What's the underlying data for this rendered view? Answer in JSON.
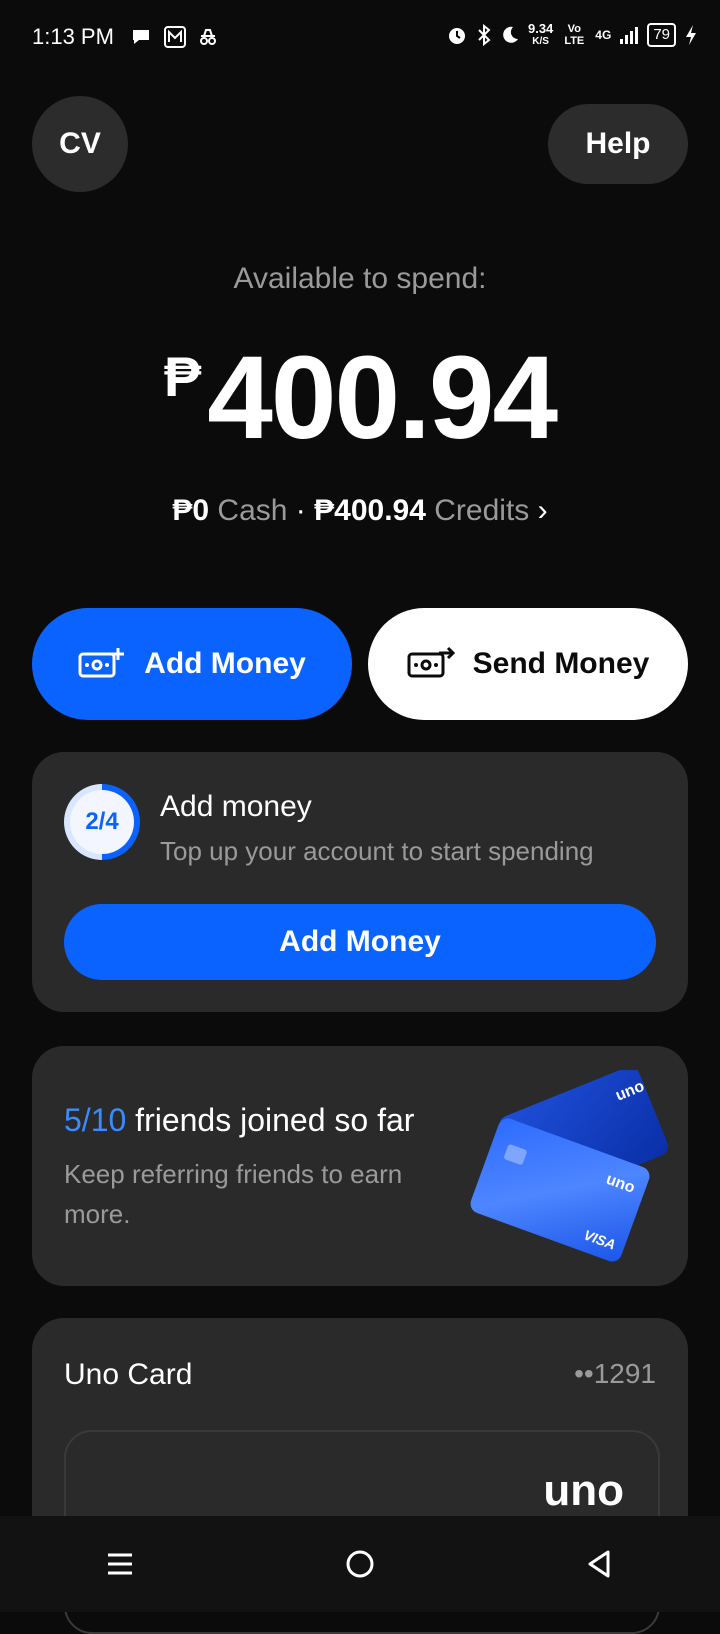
{
  "status_bar": {
    "time": "1:13 PM",
    "speed": "9.34",
    "speed_unit": "K/S",
    "network": "Vo LTE",
    "signal": "4G",
    "battery": "79"
  },
  "header": {
    "avatar_initials": "CV",
    "help_label": "Help"
  },
  "balance": {
    "label": "Available to spend:",
    "currency": "₱",
    "amount": "400.94",
    "cash_amount": "₱0",
    "cash_label": "Cash",
    "separator": "·",
    "credits_amount": "₱400.94",
    "credits_label": "Credits"
  },
  "actions": {
    "add_money": "Add Money",
    "send_money": "Send Money"
  },
  "progress_card": {
    "step": "2/4",
    "title": "Add money",
    "subtitle": "Top up your account to start spending",
    "button": "Add Money"
  },
  "referral_card": {
    "count": "5/10",
    "title": "friends joined so far",
    "subtitle": "Keep referring friends to earn more.",
    "card_brand": "uno",
    "card_network": "VISA"
  },
  "uno_card": {
    "title": "Uno Card",
    "number": "••1291",
    "brand": "uno"
  },
  "colors": {
    "accent": "#0a63ff",
    "background": "#0b0b0b",
    "card": "#2a2a2a"
  }
}
